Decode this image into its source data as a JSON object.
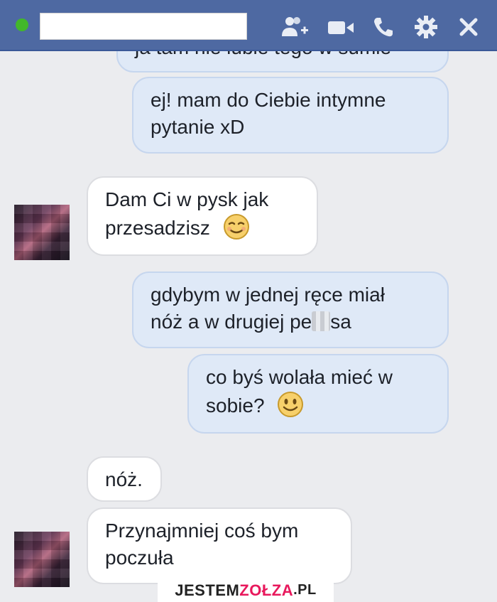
{
  "header": {
    "name_value": "",
    "icons": [
      "add-friend-icon",
      "video-call-icon",
      "phone-call-icon",
      "gear-icon",
      "close-icon"
    ],
    "bg_color": "#4e69a2",
    "status_color": "#42b72a"
  },
  "messages": [
    {
      "from": "me",
      "lines": [
        "ja tam nie lubie tego w sumie"
      ]
    },
    {
      "from": "me",
      "lines": [
        "ej! mam do Ciebie intymne",
        "pytanie xD"
      ]
    },
    {
      "from": "them",
      "lines": [
        "Dam Ci w pysk jak",
        "przesadzisz"
      ],
      "emoji": "smirk-emoji-icon"
    },
    {
      "from": "me",
      "lines": [
        "gdybym w jednej ręce miał",
        "nóż a w drugiej pe",
        "sa"
      ]
    },
    {
      "from": "me",
      "lines": [
        "co byś wolała mieć w",
        "sobie?"
      ],
      "emoji": "smile-emoji-icon"
    },
    {
      "from": "them",
      "lines": [
        "nóż."
      ]
    },
    {
      "from": "them",
      "lines": [
        "Przynajmniej coś bym",
        "poczuła"
      ]
    }
  ],
  "watermark": {
    "part1": "JESTEM",
    "part2": "ZOŁZA",
    "part3": ".PL"
  },
  "colors": {
    "outgoing_bubble": "#dfe9f7",
    "incoming_bubble": "#ffffff",
    "chat_bg": "#ebecef"
  }
}
